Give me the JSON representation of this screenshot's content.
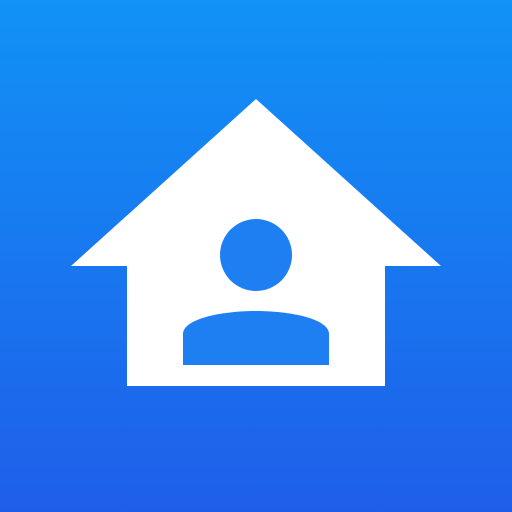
{
  "icon": {
    "name": "home-user-app-icon",
    "glyph": "house-with-person-icon",
    "colors": {
      "background_top": "#1192f6",
      "background_bottom": "#1f5ee9",
      "house": "#ffffff",
      "person": "#1e7ff2"
    }
  }
}
